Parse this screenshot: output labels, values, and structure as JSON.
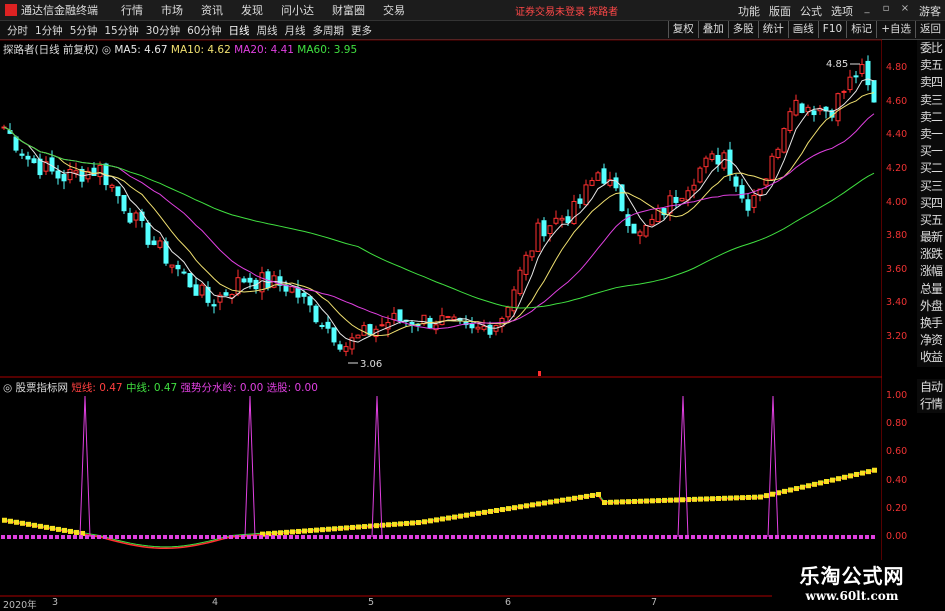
{
  "app": {
    "title": "通达信金融终端",
    "notice": "证券交易未登录",
    "account": "探路者"
  },
  "menu": [
    "行情",
    "市场",
    "资讯",
    "发现",
    "问小达",
    "财富圈",
    "交易"
  ],
  "right_menu": [
    "功能",
    "版面",
    "公式",
    "选项"
  ],
  "window_label": "游客",
  "toolbar": {
    "periods": [
      "分时",
      "1分钟",
      "5分钟",
      "15分钟",
      "30分钟",
      "60分钟",
      "日线",
      "周线",
      "月线",
      "多周期",
      "更多"
    ],
    "right_buttons": [
      "复权",
      "叠加",
      "多股",
      "统计",
      "画线",
      "F10",
      "标记",
      "+自选",
      "返回"
    ]
  },
  "main_legend": {
    "name": "探路者(日线 前复权)",
    "ma": [
      {
        "label": "MA5: 4.67",
        "color": "#e8e8e8"
      },
      {
        "label": "MA10: 4.62",
        "color": "#f0e070"
      },
      {
        "label": "MA20: 4.41",
        "color": "#e040e0"
      },
      {
        "label": "MA60: 3.95",
        "color": "#40e040"
      }
    ]
  },
  "sub_legend": {
    "name": "股票指标网",
    "items": [
      {
        "label": "短线: 0.47",
        "color": "#ff4040"
      },
      {
        "label": "中线: 0.47",
        "color": "#40e040"
      },
      {
        "label": "强势分水岭: 0.00",
        "color": "#e040e0"
      },
      {
        "label": "选股: 0.00",
        "color": "#e040e0"
      }
    ]
  },
  "price_axis": [
    "4.80",
    "4.60",
    "4.40",
    "4.20",
    "4.00",
    "3.80",
    "3.60",
    "3.40",
    "3.20"
  ],
  "sub_axis": [
    "1.00",
    "0.80",
    "0.60",
    "0.40",
    "0.20",
    "0.00"
  ],
  "annotations": {
    "high": "4.85",
    "low": "3.06"
  },
  "x_axis": [
    "2020年",
    "3",
    "4",
    "5",
    "6",
    "7"
  ],
  "right_tabs": [
    "委比",
    "卖五",
    "卖四",
    "卖三",
    "卖二",
    "卖一",
    "买一",
    "买二",
    "买三",
    "买四",
    "买五",
    "最新",
    "涨跌",
    "涨幅",
    "总量",
    "外盘",
    "换手",
    "净资",
    "收益"
  ],
  "right_tabs_sub": [
    "自动",
    "行情"
  ],
  "watermark": {
    "line1": "乐淘公式网",
    "line2": "www.60lt.com"
  },
  "chart_data": {
    "type": "candlestick",
    "price_range": [
      3.06,
      4.85
    ],
    "sub_range": [
      0,
      1
    ],
    "ma_last": {
      "MA5": 4.67,
      "MA10": 4.62,
      "MA20": 4.41,
      "MA60": 3.95
    },
    "indicator_last": {
      "短线": 0.47,
      "中线": 0.47,
      "强势分水岭": 0.0,
      "选股": 0.0
    }
  }
}
